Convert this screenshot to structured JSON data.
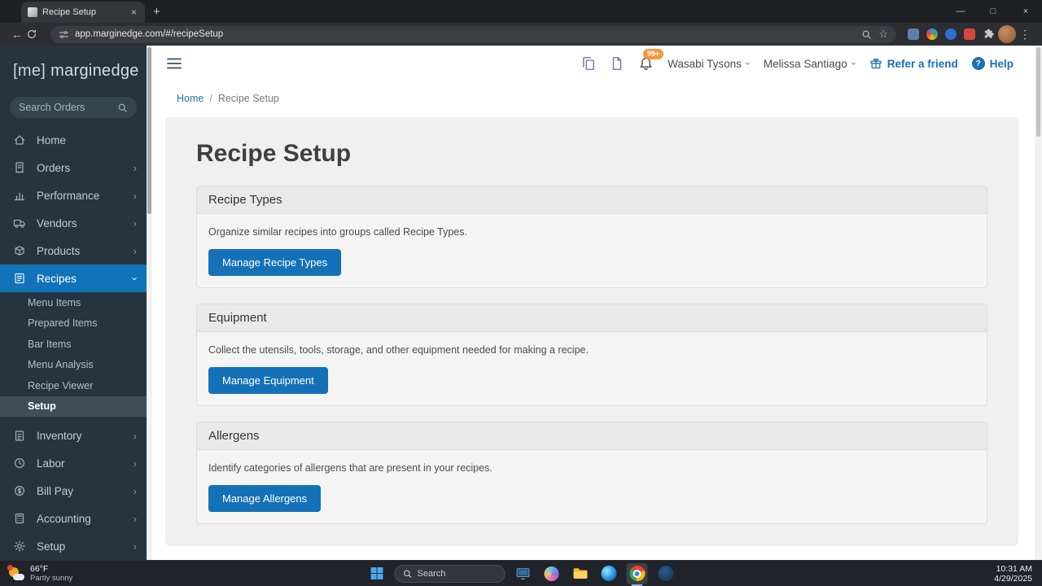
{
  "browser": {
    "tab_title": "Recipe Setup",
    "url": "app.marginedge.com/#/recipeSetup"
  },
  "icons": {
    "back": "←",
    "refresh": "⟳",
    "close": "×",
    "new_tab": "+",
    "minimize": "—",
    "maximize": "□",
    "kebab": "⋮",
    "star": "☆",
    "chevron": "›",
    "help": "?"
  },
  "sidebar": {
    "logo_me": "[me]",
    "logo_name": "marginedge",
    "search_placeholder": "Search Orders",
    "items": [
      {
        "label": "Home"
      },
      {
        "label": "Orders"
      },
      {
        "label": "Performance"
      },
      {
        "label": "Vendors"
      },
      {
        "label": "Products"
      },
      {
        "label": "Recipes"
      },
      {
        "label": "Inventory"
      },
      {
        "label": "Labor"
      },
      {
        "label": "Bill Pay"
      },
      {
        "label": "Accounting"
      },
      {
        "label": "Setup"
      }
    ],
    "recipes_submenu": [
      {
        "label": "Menu Items"
      },
      {
        "label": "Prepared Items"
      },
      {
        "label": "Bar Items"
      },
      {
        "label": "Menu Analysis"
      },
      {
        "label": "Recipe Viewer"
      },
      {
        "label": "Setup"
      }
    ]
  },
  "header": {
    "notification_badge": "99+",
    "location": "Wasabi Tysons",
    "user": "Melissa Santiago",
    "refer_label": "Refer a friend",
    "help_label": "Help"
  },
  "breadcrumb": {
    "home": "Home",
    "separator": "/",
    "current": "Recipe Setup"
  },
  "main": {
    "title": "Recipe Setup",
    "sections": [
      {
        "title": "Recipe Types",
        "description": "Organize similar recipes into groups called Recipe Types.",
        "button_label": "Manage Recipe Types"
      },
      {
        "title": "Equipment",
        "description": "Collect the utensils, tools, storage, and other equipment needed for making a recipe.",
        "button_label": "Manage Equipment"
      },
      {
        "title": "Allergens",
        "description": "Identify categories of allergens that are present in your recipes.",
        "button_label": "Manage Allergens"
      }
    ]
  },
  "taskbar": {
    "weather_temp": "66°F",
    "weather_condition": "Partly sunny",
    "search_placeholder": "Search",
    "time": "10:31 AM",
    "date": "4/29/2025"
  },
  "colors": {
    "accent_blue": "#1471b8",
    "sidebar_bg": "#26343f",
    "active_item_blue": "#1173b9",
    "badge_orange": "#f5953d"
  }
}
